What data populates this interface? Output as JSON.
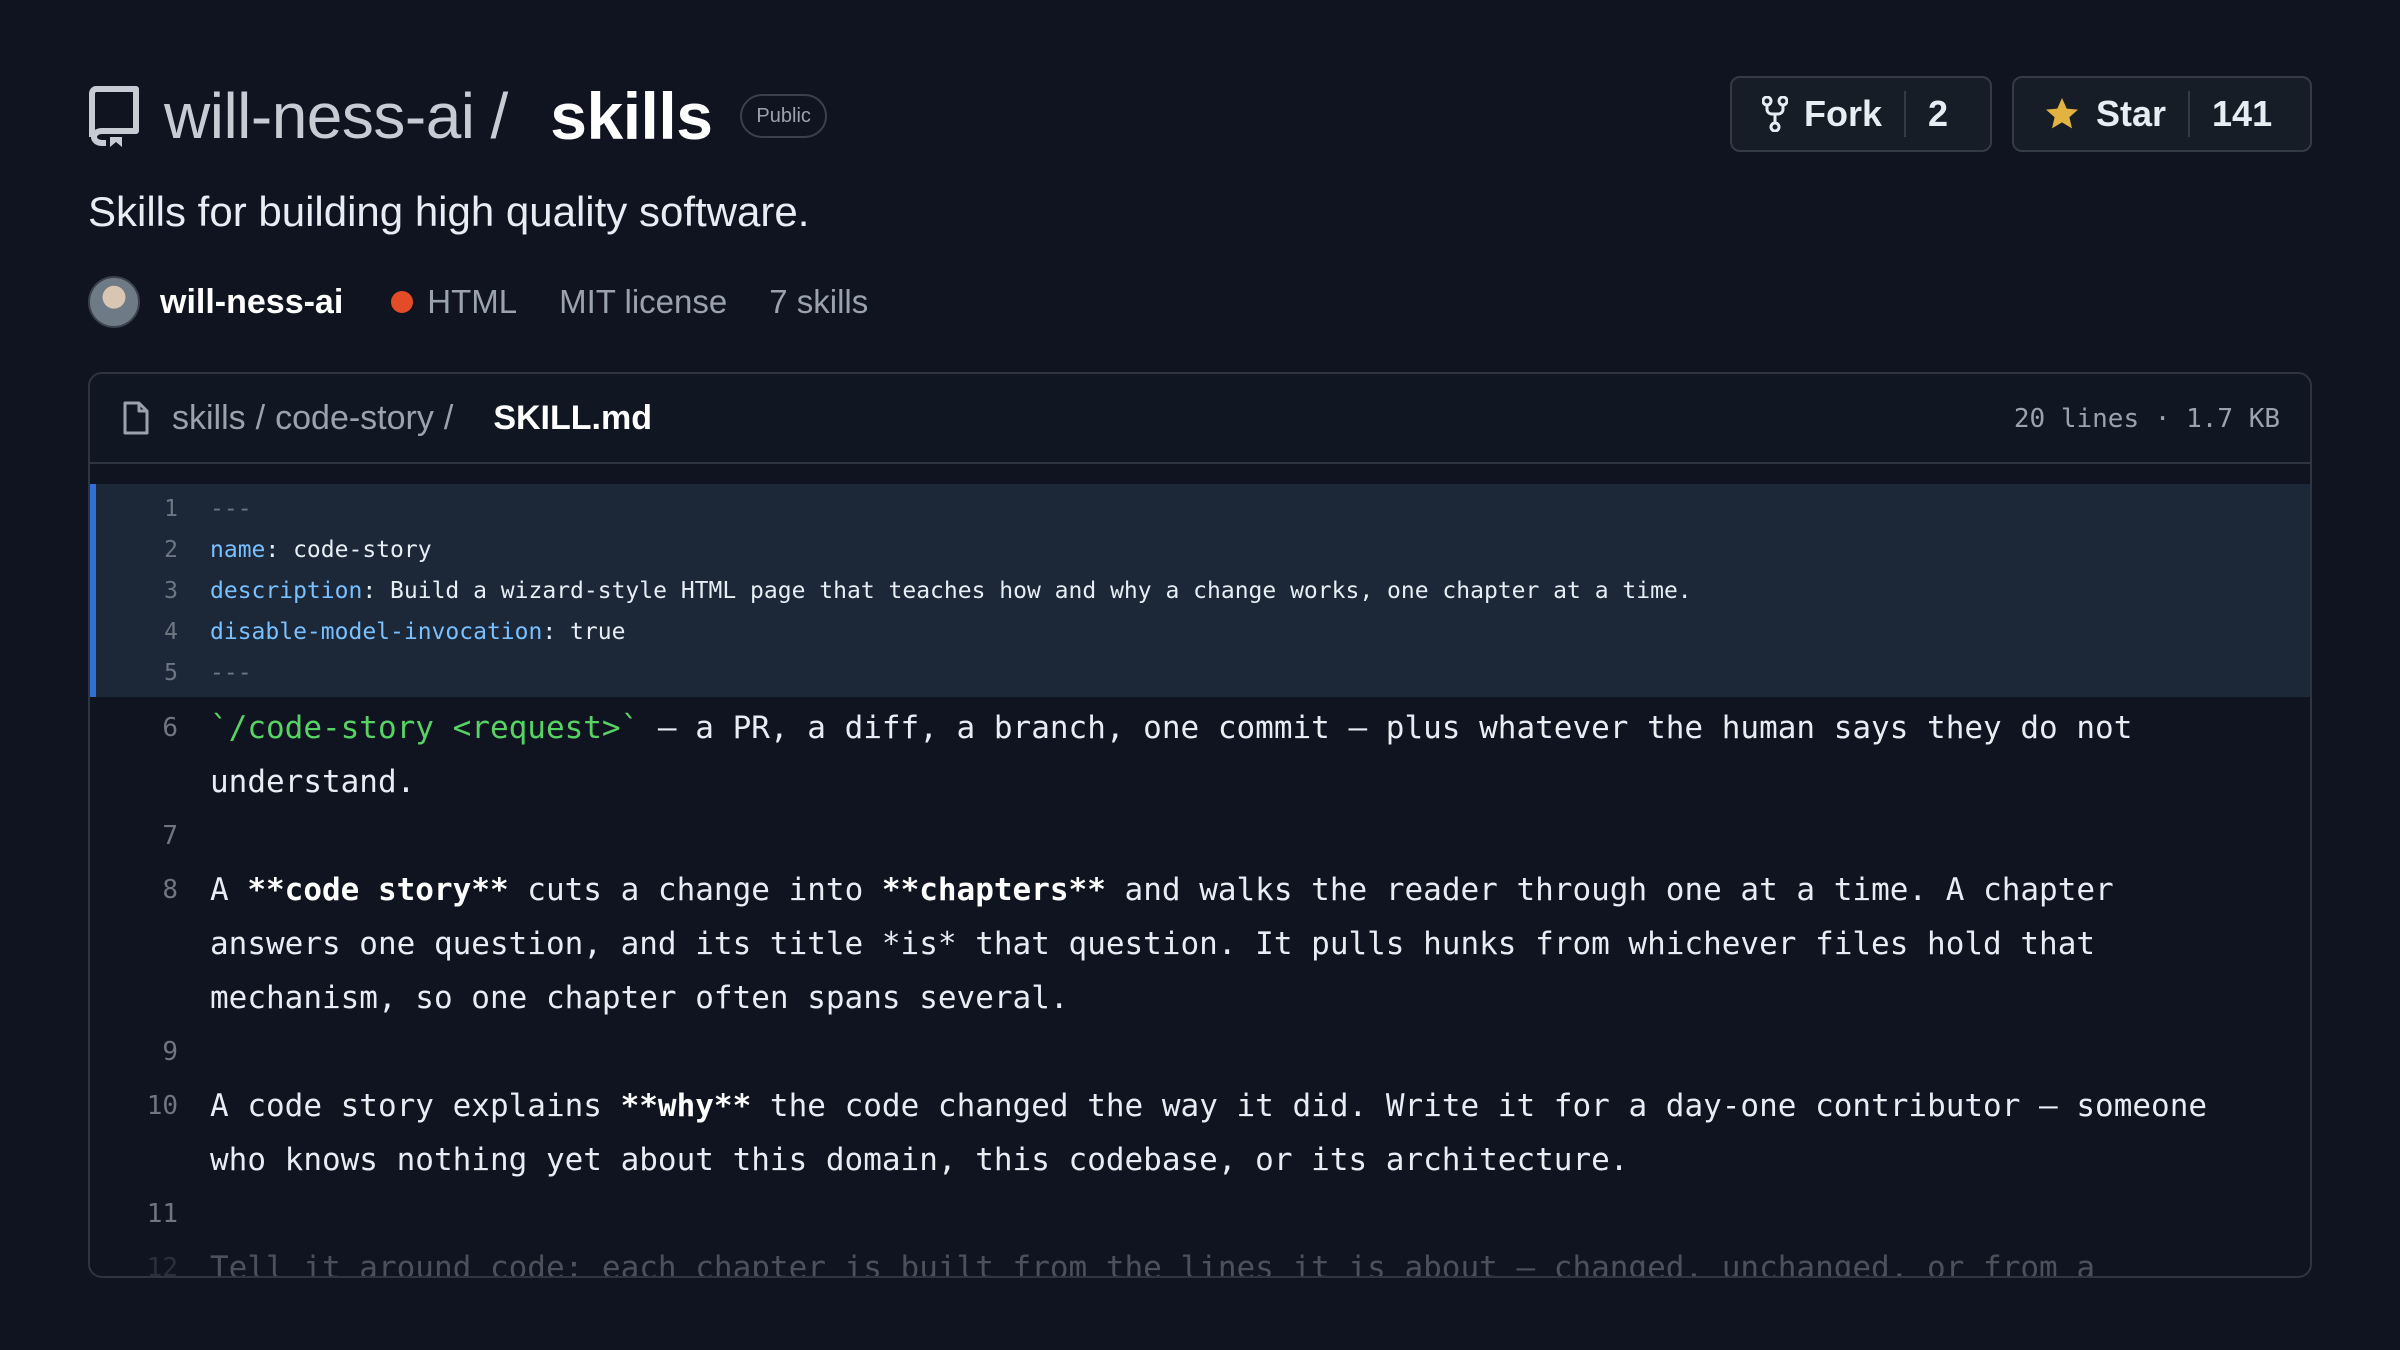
{
  "repo": {
    "owner": "will-ness-ai",
    "slash": "/",
    "name": "skills",
    "visibility": "Public",
    "description": "Skills for building high quality software."
  },
  "buttons": {
    "fork_label": "Fork",
    "fork_count": "2",
    "star_label": "Star",
    "star_count": "141"
  },
  "meta": {
    "owner": "will-ness-ai",
    "language": "HTML",
    "language_color": "#e34c26",
    "license": "MIT license",
    "skills_count": "7 skills"
  },
  "file": {
    "breadcrumb_root": "skills",
    "breadcrumb_dir": "code-story",
    "sep": "/",
    "filename": "SKILL.md",
    "stats": "20 lines · 1.7 KB"
  },
  "code": {
    "l1": {
      "n": "1",
      "text": "---"
    },
    "l2": {
      "n": "2",
      "key": "name",
      "value": ": code-story"
    },
    "l3": {
      "n": "3",
      "key": "description",
      "value": ": Build a wizard-style HTML page that teaches how and why a change works, one chapter at a time."
    },
    "l4": {
      "n": "4",
      "key": "disable-model-invocation",
      "value": ": true"
    },
    "l5": {
      "n": "5",
      "text": "---"
    },
    "l6": {
      "n": "6",
      "code": "`/code-story <request>`",
      "rest": " — a PR, a diff, a branch, one commit — plus whatever the human says they do not understand."
    },
    "l7": {
      "n": "7"
    },
    "l8": {
      "n": "8",
      "a": "A ",
      "b": "**code story**",
      "c": " cuts a change into ",
      "d": "**chapters**",
      "e": " and walks the reader through one at a time. A chapter answers one question, and its title *is* that question. It pulls hunks from whichever files hold that mechanism, so one chapter often spans several."
    },
    "l9": {
      "n": "9"
    },
    "l10": {
      "n": "10",
      "a": "A code story explains ",
      "b": "**why**",
      "c": " the code changed the way it did. Write it for a day-one contributor — someone who knows nothing yet about this domain, this codebase, or its architecture."
    },
    "l11": {
      "n": "11"
    },
    "l12": {
      "n": "12",
      "text": "Tell it around code: each chapter is built from the lines it is about — changed, unchanged, or from a"
    }
  },
  "icons": {
    "repo": "repo-icon",
    "fork": "fork-icon",
    "star": "star-icon",
    "file": "file-icon",
    "star_color": "#e3b341"
  }
}
